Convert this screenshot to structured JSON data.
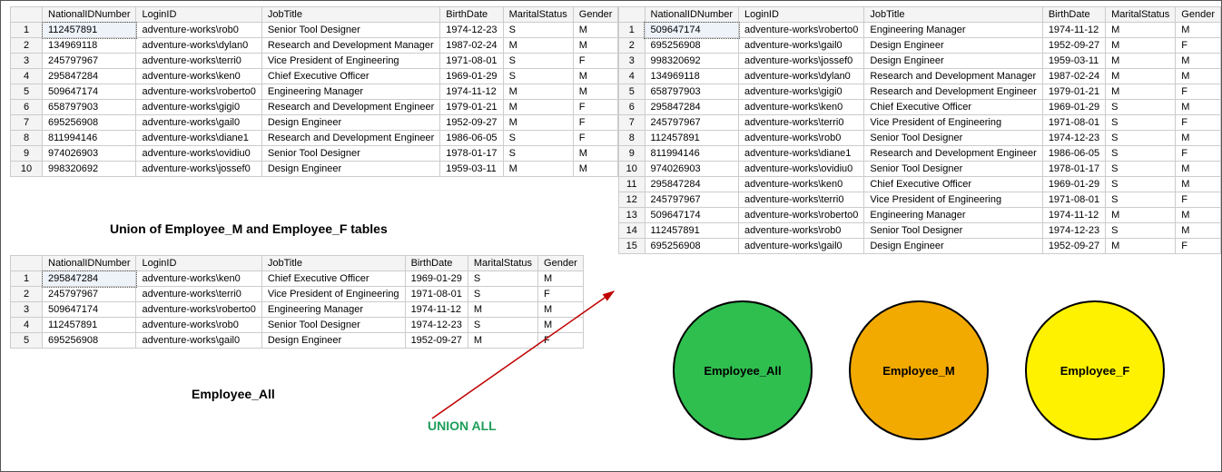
{
  "columns": [
    "NationalIDNumber",
    "LoginID",
    "JobTitle",
    "BirthDate",
    "MaritalStatus",
    "Gender"
  ],
  "table_union": {
    "caption": "Union of Employee_M and Employee_F tables",
    "rows": [
      [
        "112457891",
        "adventure-works\\rob0",
        "Senior Tool Designer",
        "1974-12-23",
        "S",
        "M"
      ],
      [
        "134969118",
        "adventure-works\\dylan0",
        "Research and Development Manager",
        "1987-02-24",
        "M",
        "M"
      ],
      [
        "245797967",
        "adventure-works\\terri0",
        "Vice President of Engineering",
        "1971-08-01",
        "S",
        "F"
      ],
      [
        "295847284",
        "adventure-works\\ken0",
        "Chief Executive Officer",
        "1969-01-29",
        "S",
        "M"
      ],
      [
        "509647174",
        "adventure-works\\roberto0",
        "Engineering Manager",
        "1974-11-12",
        "M",
        "M"
      ],
      [
        "658797903",
        "adventure-works\\gigi0",
        "Research and Development Engineer",
        "1979-01-21",
        "M",
        "F"
      ],
      [
        "695256908",
        "adventure-works\\gail0",
        "Design Engineer",
        "1952-09-27",
        "M",
        "F"
      ],
      [
        "811994146",
        "adventure-works\\diane1",
        "Research and Development Engineer",
        "1986-06-05",
        "S",
        "F"
      ],
      [
        "974026903",
        "adventure-works\\ovidiu0",
        "Senior Tool Designer",
        "1978-01-17",
        "S",
        "M"
      ],
      [
        "998320692",
        "adventure-works\\jossef0",
        "Design Engineer",
        "1959-03-11",
        "M",
        "M"
      ]
    ]
  },
  "table_all": {
    "caption": "Employee_All",
    "rows": [
      [
        "295847284",
        "adventure-works\\ken0",
        "Chief Executive Officer",
        "1969-01-29",
        "S",
        "M"
      ],
      [
        "245797967",
        "adventure-works\\terri0",
        "Vice President of Engineering",
        "1971-08-01",
        "S",
        "F"
      ],
      [
        "509647174",
        "adventure-works\\roberto0",
        "Engineering Manager",
        "1974-11-12",
        "M",
        "M"
      ],
      [
        "112457891",
        "adventure-works\\rob0",
        "Senior Tool Designer",
        "1974-12-23",
        "S",
        "M"
      ],
      [
        "695256908",
        "adventure-works\\gail0",
        "Design Engineer",
        "1952-09-27",
        "M",
        "F"
      ]
    ]
  },
  "table_unionall": {
    "rows": [
      [
        "509647174",
        "adventure-works\\roberto0",
        "Engineering Manager",
        "1974-11-12",
        "M",
        "M"
      ],
      [
        "695256908",
        "adventure-works\\gail0",
        "Design Engineer",
        "1952-09-27",
        "M",
        "F"
      ],
      [
        "998320692",
        "adventure-works\\jossef0",
        "Design Engineer",
        "1959-03-11",
        "M",
        "M"
      ],
      [
        "134969118",
        "adventure-works\\dylan0",
        "Research and Development Manager",
        "1987-02-24",
        "M",
        "M"
      ],
      [
        "658797903",
        "adventure-works\\gigi0",
        "Research and Development Engineer",
        "1979-01-21",
        "M",
        "F"
      ],
      [
        "295847284",
        "adventure-works\\ken0",
        "Chief Executive Officer",
        "1969-01-29",
        "S",
        "M"
      ],
      [
        "245797967",
        "adventure-works\\terri0",
        "Vice President of Engineering",
        "1971-08-01",
        "S",
        "F"
      ],
      [
        "112457891",
        "adventure-works\\rob0",
        "Senior Tool Designer",
        "1974-12-23",
        "S",
        "M"
      ],
      [
        "811994146",
        "adventure-works\\diane1",
        "Research and Development Engineer",
        "1986-06-05",
        "S",
        "F"
      ],
      [
        "974026903",
        "adventure-works\\ovidiu0",
        "Senior Tool Designer",
        "1978-01-17",
        "S",
        "M"
      ],
      [
        "295847284",
        "adventure-works\\ken0",
        "Chief Executive Officer",
        "1969-01-29",
        "S",
        "M"
      ],
      [
        "245797967",
        "adventure-works\\terri0",
        "Vice President of Engineering",
        "1971-08-01",
        "S",
        "F"
      ],
      [
        "509647174",
        "adventure-works\\roberto0",
        "Engineering Manager",
        "1974-11-12",
        "M",
        "M"
      ],
      [
        "112457891",
        "adventure-works\\rob0",
        "Senior Tool Designer",
        "1974-12-23",
        "S",
        "M"
      ],
      [
        "695256908",
        "adventure-works\\gail0",
        "Design Engineer",
        "1952-09-27",
        "M",
        "F"
      ]
    ]
  },
  "arrow_label": "UNION ALL",
  "circles": [
    {
      "label": "Employee_All",
      "class": "c-green"
    },
    {
      "label": "Employee_M",
      "class": "c-orange"
    },
    {
      "label": "Employee_F",
      "class": "c-yellow"
    }
  ]
}
